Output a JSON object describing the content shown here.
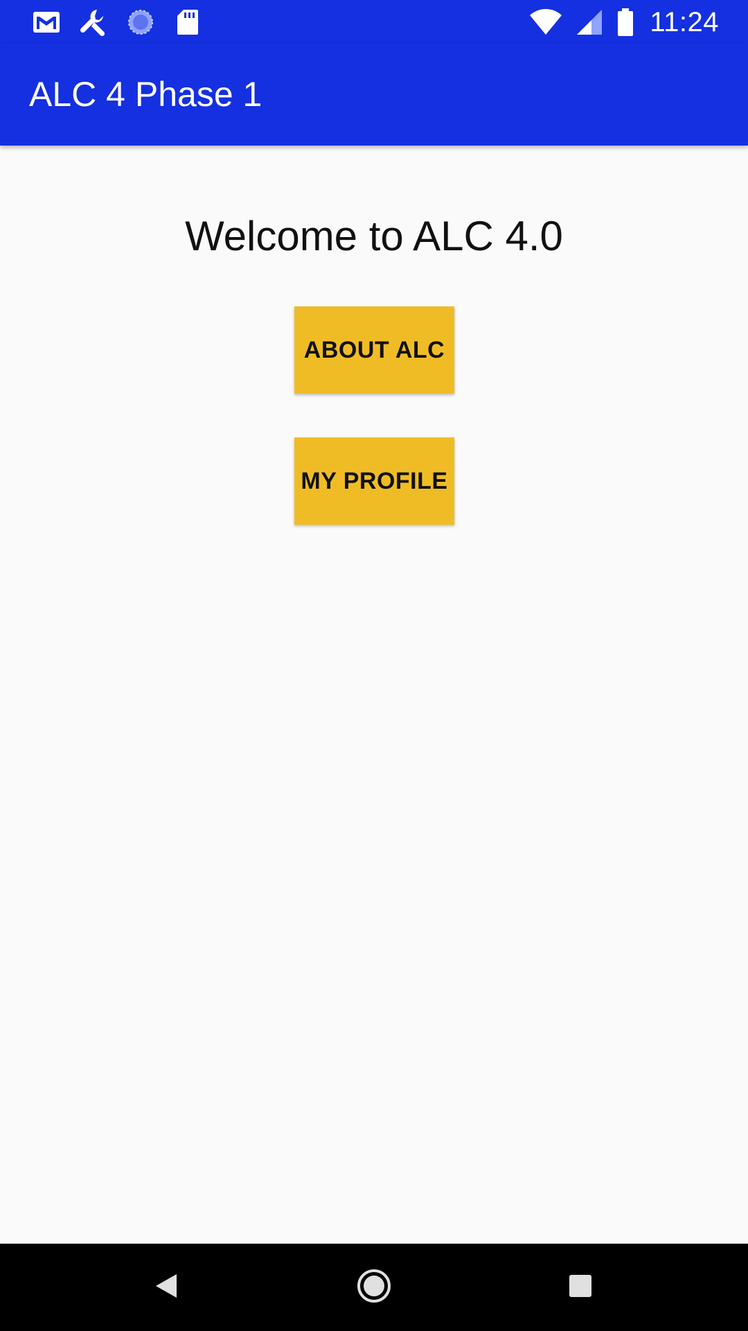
{
  "status_bar": {
    "time": "11:24",
    "icons": [
      "gmail-icon",
      "wrench-icon",
      "sync-progress-icon",
      "sd-card-icon",
      "wifi-icon",
      "cell-signal-icon",
      "battery-icon"
    ]
  },
  "app_bar": {
    "title": "ALC 4 Phase 1"
  },
  "main": {
    "welcome_text": "Welcome to ALC 4.0",
    "buttons": {
      "about": "ABOUT ALC",
      "profile": "MY PROFILE"
    }
  },
  "nav_bar": {
    "icons": [
      "back-icon",
      "home-icon",
      "recents-icon"
    ]
  },
  "colors": {
    "primary": "#1530e0",
    "accent_button": "#f0bc26",
    "background": "#fafafa",
    "nav_bar": "#000000"
  }
}
